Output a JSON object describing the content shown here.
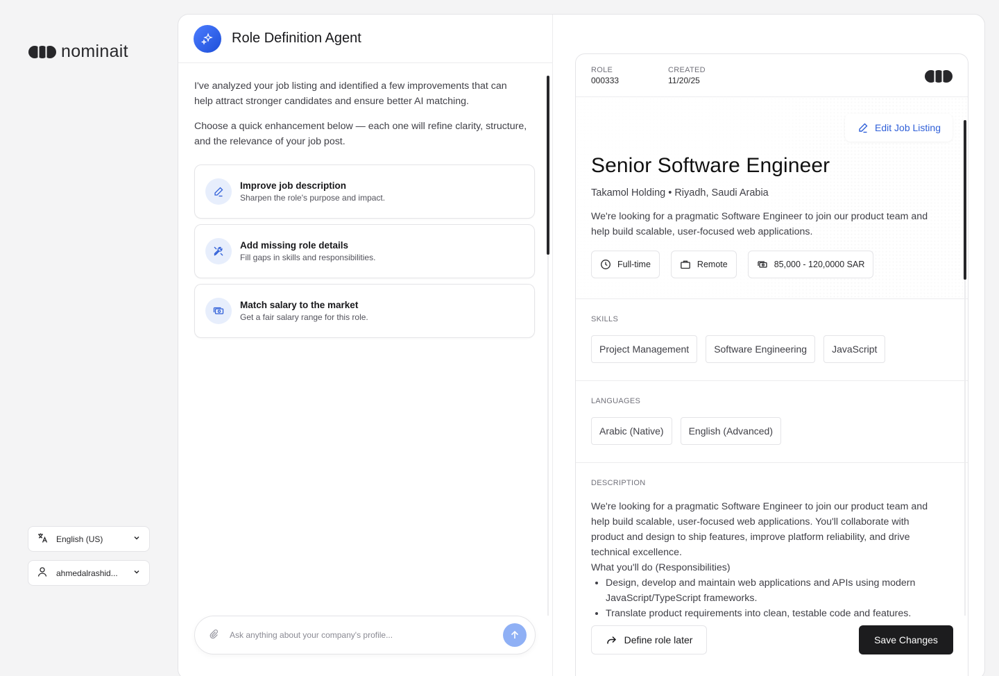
{
  "brand": {
    "name": "nominait"
  },
  "sidebar": {
    "language": {
      "label": "English (US)"
    },
    "user": {
      "label": "ahmedalrashid..."
    }
  },
  "chat": {
    "title": "Role Definition Agent",
    "messages": [
      "I've analyzed your job listing and identified a few improvements that can help attract stronger candidates and ensure better AI matching.",
      "Choose a quick enhancement below — each one will refine clarity, structure, and the relevance of your job post."
    ],
    "actions": [
      {
        "title": "Improve job description",
        "subtitle": "Sharpen the role's purpose and impact.",
        "icon": "pencil-icon"
      },
      {
        "title": "Add missing role details",
        "subtitle": "Fill gaps in skills and responsibilities.",
        "icon": "tools-icon"
      },
      {
        "title": "Match salary to the market",
        "subtitle": "Get a fair salary range for this role.",
        "icon": "money-icon"
      }
    ],
    "composer": {
      "placeholder": "Ask anything about your company's profile..."
    }
  },
  "job": {
    "meta": {
      "role_label": "ROLE",
      "role_value": "000333",
      "created_label": "CREATED",
      "created_value": "11/20/25"
    },
    "edit_label": "Edit Job Listing",
    "title": "Senior Software Engineer",
    "company_line": "Takamol Holding • Riyadh, Saudi Arabia",
    "summary": "We're looking for a pragmatic Software Engineer to join our product team and help build scalable, user-focused web applications.",
    "chips": {
      "type": "Full-time",
      "location": "Remote",
      "salary": "85,000 - 120,0000 SAR"
    },
    "skills_label": "SKILLS",
    "skills": [
      "Project Management",
      "Software Engineering",
      "JavaScript"
    ],
    "languages_label": "LANGUAGES",
    "languages": [
      "Arabic (Native)",
      "English (Advanced)"
    ],
    "description_label": "DESCRIPTION",
    "description": {
      "intro": "We're looking for a pragmatic Software Engineer to join our product team and help build scalable, user-focused web applications. You'll collaborate with product and design to ship features, improve platform reliability, and drive technical excellence.",
      "heading": "What you'll do (Responsibilities)",
      "bullets": [
        "Design, develop and maintain web applications and APIs using modern JavaScript/TypeScript frameworks.",
        "Translate product requirements into clean, testable code and features."
      ]
    }
  },
  "footer": {
    "later_label": "Define role later",
    "save_label": "Save Changes"
  }
}
